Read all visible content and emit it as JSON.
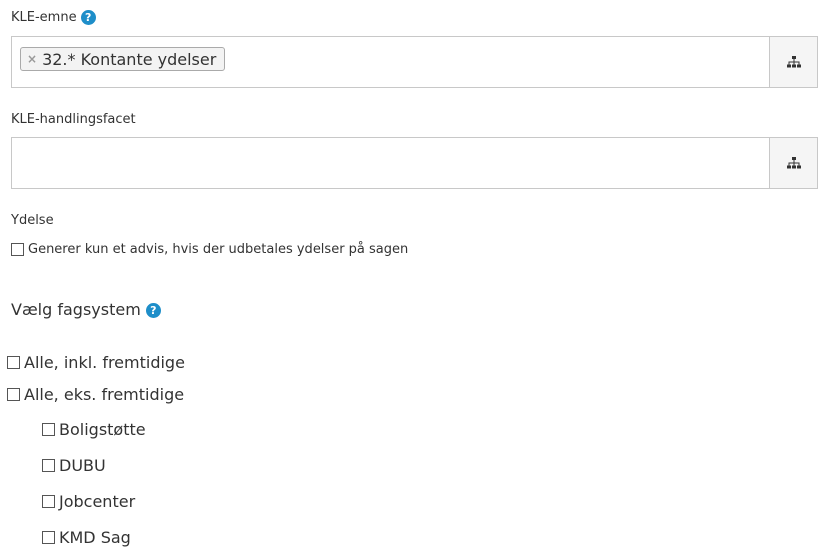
{
  "kle_emne": {
    "label": "KLE-emne",
    "help": "?",
    "tag_remove": "×",
    "tag_text": "32.* Kontante ydelser",
    "tree_icon": "sitemap-icon"
  },
  "kle_handlingsfacet": {
    "label": "KLE-handlingsfacet",
    "value": "",
    "tree_icon": "sitemap-icon"
  },
  "ydelse": {
    "label": "Ydelse",
    "checkbox_label": "Generer kun et advis, hvis der udbetales ydelser på sagen"
  },
  "fagsystem": {
    "heading": "Vælg fagsystem",
    "help": "?",
    "options": [
      {
        "label": "Alle, inkl. fremtidige"
      },
      {
        "label": "Alle, eks. fremtidige"
      }
    ],
    "sub_options": [
      {
        "label": "Boligstøtte"
      },
      {
        "label": "DUBU"
      },
      {
        "label": "Jobcenter"
      },
      {
        "label": "KMD Sag"
      }
    ]
  }
}
